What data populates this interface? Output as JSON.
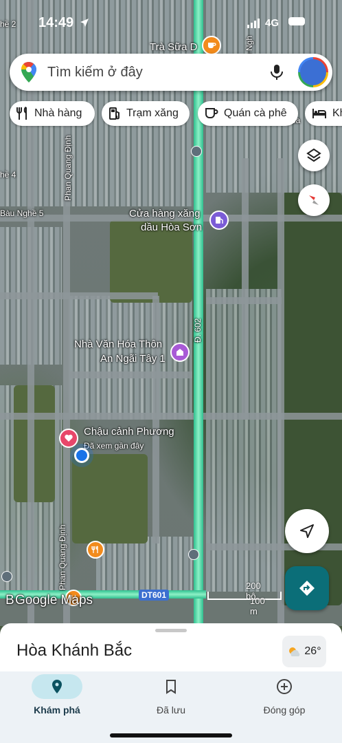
{
  "status": {
    "time": "14:49",
    "network": "4G"
  },
  "search": {
    "placeholder": "Tìm kiếm ở đây"
  },
  "chips": [
    {
      "label": "Nhà hàng",
      "icon": "fork-knife-icon"
    },
    {
      "label": "Trạm xăng",
      "icon": "gas-station-icon"
    },
    {
      "label": "Quán cà phê",
      "icon": "coffee-icon"
    },
    {
      "label": "Kh",
      "icon": "bed-icon"
    }
  ],
  "map": {
    "labels": {
      "tra_sua": "Trà Sữa D",
      "cua_hang_1": "Cửa hàng xăng",
      "cua_hang_2": "dầu Hòa Sơn",
      "nha_van_hoa_1": "Nhà Văn Hóa Thôn",
      "nha_van_hoa_2": "An Ngãi Tây 1",
      "chau_canh": "Chậu cảnh Phương",
      "da_xem": "Đã xem gần đây",
      "bau_nghe5": "Bàu Nghề 5",
      "nghe2": "hề 2",
      "nghe4": "hề 4",
      "phan_quang_1": "Phan Quang Định",
      "phan_quang_2": "Phan Quang Định",
      "d602": "Đ. 602",
      "dt601": "DT601",
      "nghe_top": "u Ngh",
      "oa": "oa",
      "b_left": "B"
    },
    "logo": "Google Maps",
    "scale": {
      "top": "200 bộ",
      "bottom": "100 m"
    }
  },
  "sheet": {
    "title": "Hòa Khánh Bắc",
    "temperature": "26°"
  },
  "nav": [
    {
      "label": "Khám phá",
      "icon": "explore-pin-icon",
      "active": true
    },
    {
      "label": "Đã lưu",
      "icon": "bookmark-icon",
      "active": false
    },
    {
      "label": "Đóng góp",
      "icon": "add-circle-icon",
      "active": false
    }
  ],
  "colors": {
    "accent": "#0b6e78",
    "highway": "#2fbf8f",
    "favorite": "#e8476a",
    "location": "#1a73e8"
  }
}
